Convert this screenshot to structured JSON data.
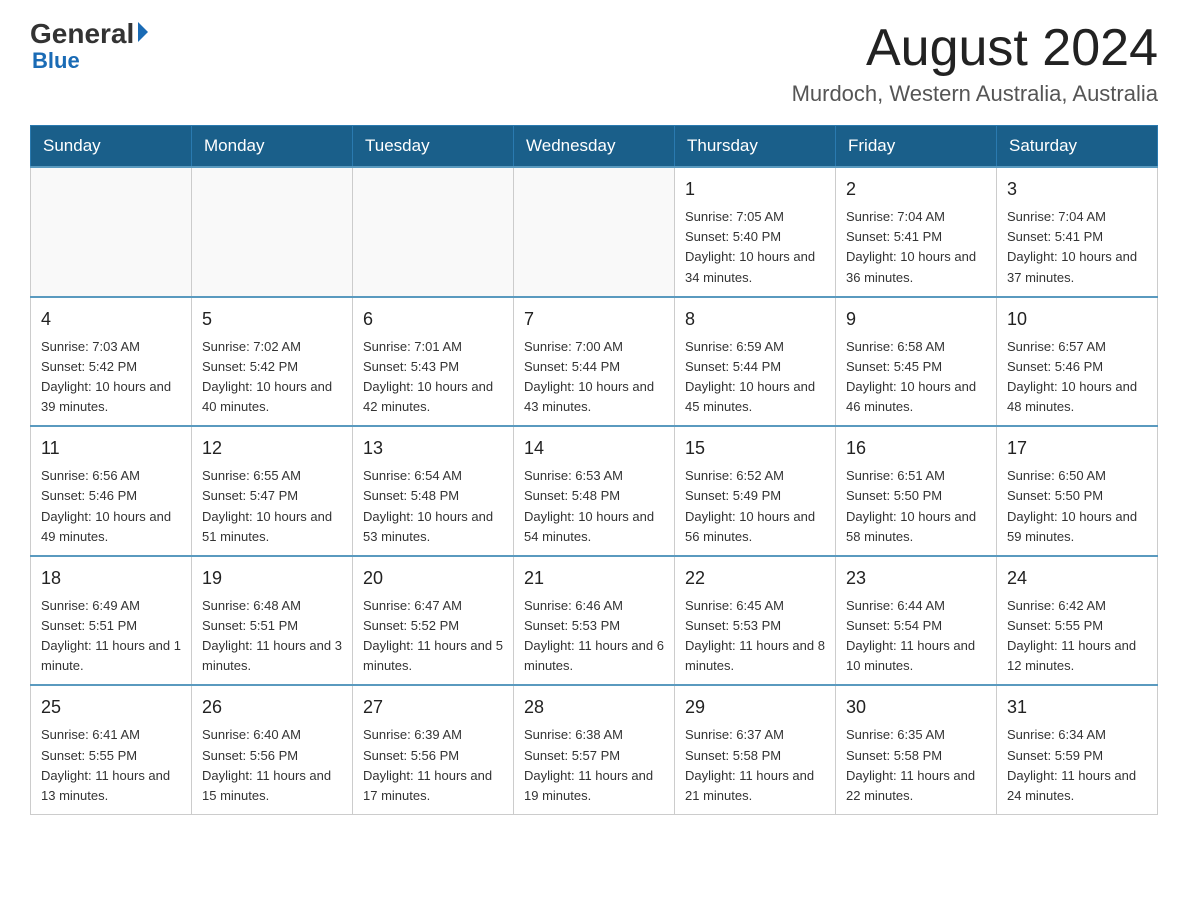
{
  "header": {
    "logo_general": "General",
    "logo_blue": "Blue",
    "main_title": "August 2024",
    "subtitle": "Murdoch, Western Australia, Australia"
  },
  "days_of_week": [
    "Sunday",
    "Monday",
    "Tuesday",
    "Wednesday",
    "Thursday",
    "Friday",
    "Saturday"
  ],
  "weeks": [
    {
      "days": [
        {
          "number": "",
          "info": ""
        },
        {
          "number": "",
          "info": ""
        },
        {
          "number": "",
          "info": ""
        },
        {
          "number": "",
          "info": ""
        },
        {
          "number": "1",
          "info": "Sunrise: 7:05 AM\nSunset: 5:40 PM\nDaylight: 10 hours\nand 34 minutes."
        },
        {
          "number": "2",
          "info": "Sunrise: 7:04 AM\nSunset: 5:41 PM\nDaylight: 10 hours\nand 36 minutes."
        },
        {
          "number": "3",
          "info": "Sunrise: 7:04 AM\nSunset: 5:41 PM\nDaylight: 10 hours\nand 37 minutes."
        }
      ]
    },
    {
      "days": [
        {
          "number": "4",
          "info": "Sunrise: 7:03 AM\nSunset: 5:42 PM\nDaylight: 10 hours\nand 39 minutes."
        },
        {
          "number": "5",
          "info": "Sunrise: 7:02 AM\nSunset: 5:42 PM\nDaylight: 10 hours\nand 40 minutes."
        },
        {
          "number": "6",
          "info": "Sunrise: 7:01 AM\nSunset: 5:43 PM\nDaylight: 10 hours\nand 42 minutes."
        },
        {
          "number": "7",
          "info": "Sunrise: 7:00 AM\nSunset: 5:44 PM\nDaylight: 10 hours\nand 43 minutes."
        },
        {
          "number": "8",
          "info": "Sunrise: 6:59 AM\nSunset: 5:44 PM\nDaylight: 10 hours\nand 45 minutes."
        },
        {
          "number": "9",
          "info": "Sunrise: 6:58 AM\nSunset: 5:45 PM\nDaylight: 10 hours\nand 46 minutes."
        },
        {
          "number": "10",
          "info": "Sunrise: 6:57 AM\nSunset: 5:46 PM\nDaylight: 10 hours\nand 48 minutes."
        }
      ]
    },
    {
      "days": [
        {
          "number": "11",
          "info": "Sunrise: 6:56 AM\nSunset: 5:46 PM\nDaylight: 10 hours\nand 49 minutes."
        },
        {
          "number": "12",
          "info": "Sunrise: 6:55 AM\nSunset: 5:47 PM\nDaylight: 10 hours\nand 51 minutes."
        },
        {
          "number": "13",
          "info": "Sunrise: 6:54 AM\nSunset: 5:48 PM\nDaylight: 10 hours\nand 53 minutes."
        },
        {
          "number": "14",
          "info": "Sunrise: 6:53 AM\nSunset: 5:48 PM\nDaylight: 10 hours\nand 54 minutes."
        },
        {
          "number": "15",
          "info": "Sunrise: 6:52 AM\nSunset: 5:49 PM\nDaylight: 10 hours\nand 56 minutes."
        },
        {
          "number": "16",
          "info": "Sunrise: 6:51 AM\nSunset: 5:50 PM\nDaylight: 10 hours\nand 58 minutes."
        },
        {
          "number": "17",
          "info": "Sunrise: 6:50 AM\nSunset: 5:50 PM\nDaylight: 10 hours\nand 59 minutes."
        }
      ]
    },
    {
      "days": [
        {
          "number": "18",
          "info": "Sunrise: 6:49 AM\nSunset: 5:51 PM\nDaylight: 11 hours\nand 1 minute."
        },
        {
          "number": "19",
          "info": "Sunrise: 6:48 AM\nSunset: 5:51 PM\nDaylight: 11 hours\nand 3 minutes."
        },
        {
          "number": "20",
          "info": "Sunrise: 6:47 AM\nSunset: 5:52 PM\nDaylight: 11 hours\nand 5 minutes."
        },
        {
          "number": "21",
          "info": "Sunrise: 6:46 AM\nSunset: 5:53 PM\nDaylight: 11 hours\nand 6 minutes."
        },
        {
          "number": "22",
          "info": "Sunrise: 6:45 AM\nSunset: 5:53 PM\nDaylight: 11 hours\nand 8 minutes."
        },
        {
          "number": "23",
          "info": "Sunrise: 6:44 AM\nSunset: 5:54 PM\nDaylight: 11 hours\nand 10 minutes."
        },
        {
          "number": "24",
          "info": "Sunrise: 6:42 AM\nSunset: 5:55 PM\nDaylight: 11 hours\nand 12 minutes."
        }
      ]
    },
    {
      "days": [
        {
          "number": "25",
          "info": "Sunrise: 6:41 AM\nSunset: 5:55 PM\nDaylight: 11 hours\nand 13 minutes."
        },
        {
          "number": "26",
          "info": "Sunrise: 6:40 AM\nSunset: 5:56 PM\nDaylight: 11 hours\nand 15 minutes."
        },
        {
          "number": "27",
          "info": "Sunrise: 6:39 AM\nSunset: 5:56 PM\nDaylight: 11 hours\nand 17 minutes."
        },
        {
          "number": "28",
          "info": "Sunrise: 6:38 AM\nSunset: 5:57 PM\nDaylight: 11 hours\nand 19 minutes."
        },
        {
          "number": "29",
          "info": "Sunrise: 6:37 AM\nSunset: 5:58 PM\nDaylight: 11 hours\nand 21 minutes."
        },
        {
          "number": "30",
          "info": "Sunrise: 6:35 AM\nSunset: 5:58 PM\nDaylight: 11 hours\nand 22 minutes."
        },
        {
          "number": "31",
          "info": "Sunrise: 6:34 AM\nSunset: 5:59 PM\nDaylight: 11 hours\nand 24 minutes."
        }
      ]
    }
  ]
}
